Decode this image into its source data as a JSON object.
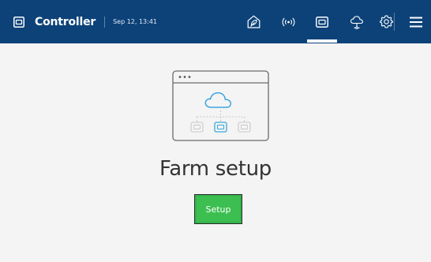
{
  "header": {
    "app_icon": "controller-icon",
    "title": "Controller",
    "datetime": "Sep 12, 13:41",
    "nav_icons": [
      "farm-icon",
      "wireless-icon",
      "controller-icon",
      "cloud-icon",
      "settings-icon",
      "menu-icon"
    ],
    "active_nav": "controller-icon"
  },
  "main": {
    "illustration": "cloud-network-icon",
    "title": "Farm setup",
    "setup_label": "Setup"
  },
  "colors": {
    "header_bg": "#0d4279",
    "page_bg": "#f4f4f4",
    "accent_blue": "#3aa6dc",
    "button_green": "#3cbf50"
  }
}
